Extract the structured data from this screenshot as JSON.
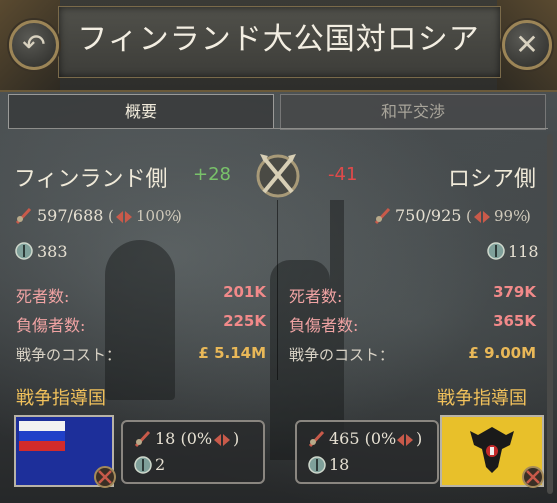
{
  "window": {
    "title": "フィンランド大公国対ロシア",
    "back_icon": "back-arrow-icon",
    "close_icon": "close-icon"
  },
  "tabs": [
    {
      "label": "概要",
      "active": true
    },
    {
      "label": "和平交渉",
      "active": false
    }
  ],
  "left": {
    "name": "フィンランド側",
    "score": "+28",
    "army": "597/688",
    "army_pct": "100%",
    "navy": "383",
    "deaths_label": "死者数:",
    "deaths": "201K",
    "wounded_label": "負傷者数:",
    "wounded": "225K",
    "cost_label": "戦争のコスト：",
    "cost": "5.14M",
    "leader_heading": "戦争指導国",
    "leader_army": "18 (0%",
    "leader_navy": "2",
    "flag": "russia-flag-on-blue"
  },
  "right": {
    "name": "ロシア側",
    "score": "-41",
    "army": "750/925",
    "army_pct": "99%",
    "navy": "118",
    "deaths_label": "死者数:",
    "deaths": "379K",
    "wounded_label": "負傷者数:",
    "wounded": "365K",
    "cost_label": "戦争のコスト：",
    "cost": "9.00M",
    "leader_heading": "戦争指導国",
    "leader_army": "465 (0%",
    "leader_navy": "18",
    "flag": "imperial-eagle-flag"
  },
  "currency_symbol": "£",
  "colors": {
    "positive": "#79c26a",
    "negative": "#e04a4a",
    "gold": "#f1c15b",
    "casualty": "#f28a8a"
  }
}
